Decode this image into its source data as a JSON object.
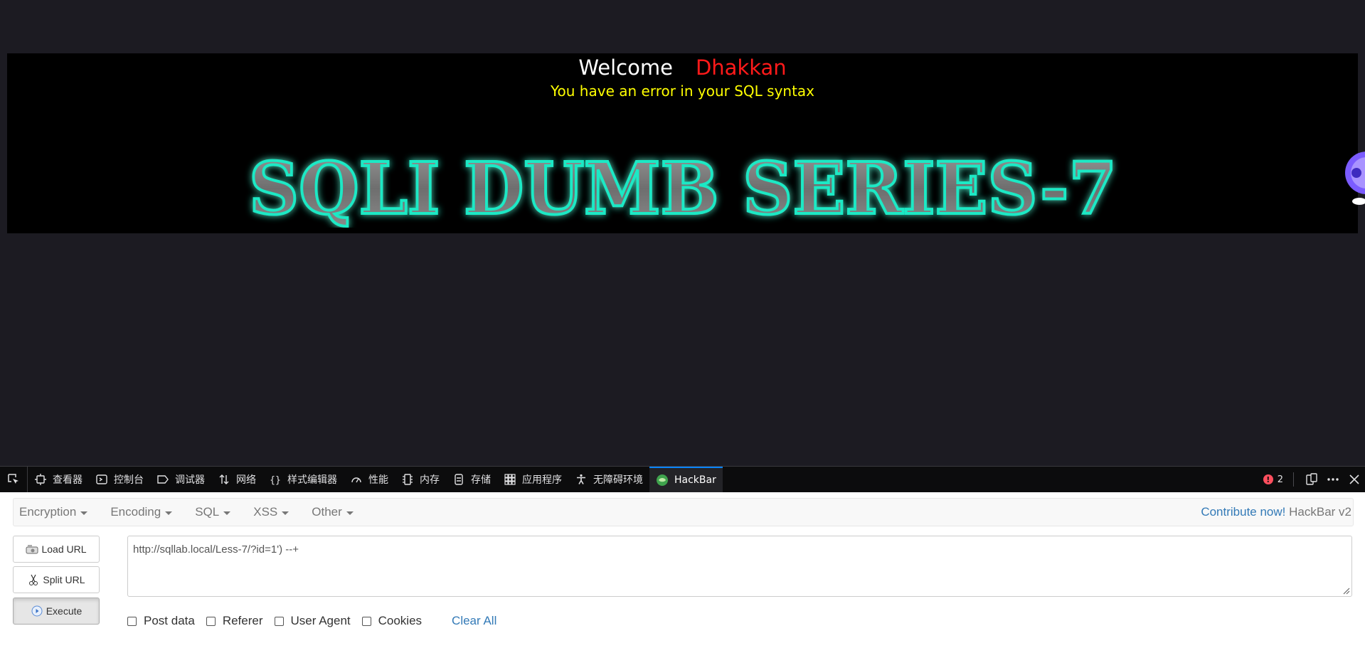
{
  "page": {
    "welcome_label": "Welcome",
    "user_name": "Dhakkan",
    "error_message": "You have an error in your SQL syntax",
    "title_image_text": "SQLI DUMB SERIES-7"
  },
  "devtools": {
    "tabs": [
      {
        "label": "查看器",
        "icon": "inspector-icon"
      },
      {
        "label": "控制台",
        "icon": "console-icon"
      },
      {
        "label": "调试器",
        "icon": "debugger-icon"
      },
      {
        "label": "网络",
        "icon": "network-icon"
      },
      {
        "label": "样式编辑器",
        "icon": "style-editor-icon"
      },
      {
        "label": "性能",
        "icon": "performance-icon"
      },
      {
        "label": "内存",
        "icon": "memory-icon"
      },
      {
        "label": "存储",
        "icon": "storage-icon"
      },
      {
        "label": "应用程序",
        "icon": "application-icon"
      },
      {
        "label": "无障碍环境",
        "icon": "accessibility-icon"
      },
      {
        "label": "HackBar",
        "icon": "hackbar-icon",
        "active": true
      }
    ],
    "error_count": "2"
  },
  "hackbar": {
    "menu": {
      "encryption": "Encryption",
      "encoding": "Encoding",
      "sql": "SQL",
      "xss": "XSS",
      "other": "Other"
    },
    "contribute": "Contribute now!",
    "version": "HackBar v2",
    "buttons": {
      "load_url": "Load URL",
      "split_url": "Split URL",
      "execute": "Execute"
    },
    "url_value": "http://sqllab.local/Less-7/?id=1') --+",
    "options": {
      "post_data": "Post data",
      "referer": "Referer",
      "user_agent": "User Agent",
      "cookies": "Cookies",
      "clear_all": "Clear All"
    }
  },
  "colors": {
    "page_bg": "#1c1b22",
    "welcome": "#ffffff",
    "user_name": "#ff1a1a",
    "error": "#ffff00",
    "title_glow": "#1de9c5",
    "link": "#337ab7",
    "devtools_bar": "#0c0c0d",
    "active_tab_accent": "#0a84ff"
  }
}
